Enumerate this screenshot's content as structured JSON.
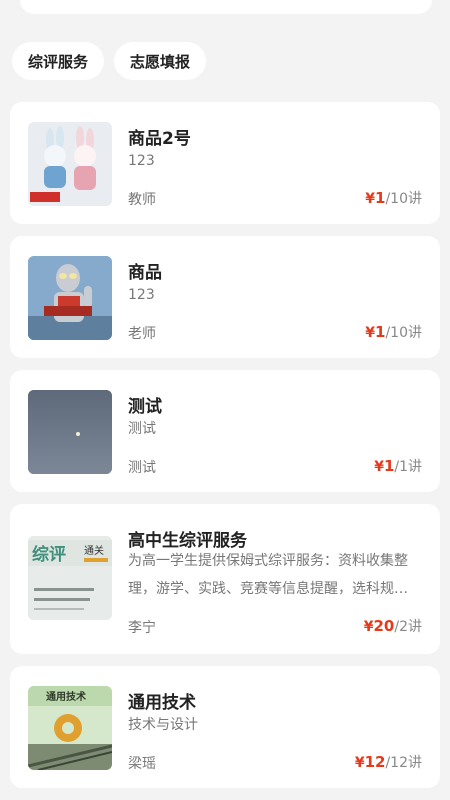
{
  "chips": [
    {
      "label": "综评服务"
    },
    {
      "label": "志愿填报"
    }
  ],
  "currency": "¥",
  "items": [
    {
      "title": "商品2号",
      "desc": "123",
      "teacher": "教师",
      "price": "1",
      "lessons": "/10讲",
      "image": "crochet-bunny-dolls-image"
    },
    {
      "title": "商品",
      "desc": "123",
      "teacher": "老师",
      "price": "1",
      "lessons": "/10讲",
      "image": "ultraman-figure-image"
    },
    {
      "title": "测试",
      "desc": "测试",
      "teacher": "测试",
      "price": "1",
      "lessons": "/1讲",
      "image": "night-sky-moon-image"
    },
    {
      "title": "高中生综评服务",
      "desc": "为高一学生提供保姆式综评服务：资料收集整理，游学、实践、竞赛等信息提醒，选科规划指导",
      "teacher": "李宁",
      "price": "20",
      "lessons": "/2讲",
      "image": "comprehensive-evaluation-book-image",
      "cover_text": "综评",
      "cover_sub": "通关"
    },
    {
      "title": "通用技术",
      "desc": "技术与设计",
      "teacher": "梁瑶",
      "price": "12",
      "lessons": "/12讲",
      "image": "general-technology-book-image",
      "cover_text": "通用技术"
    }
  ]
}
